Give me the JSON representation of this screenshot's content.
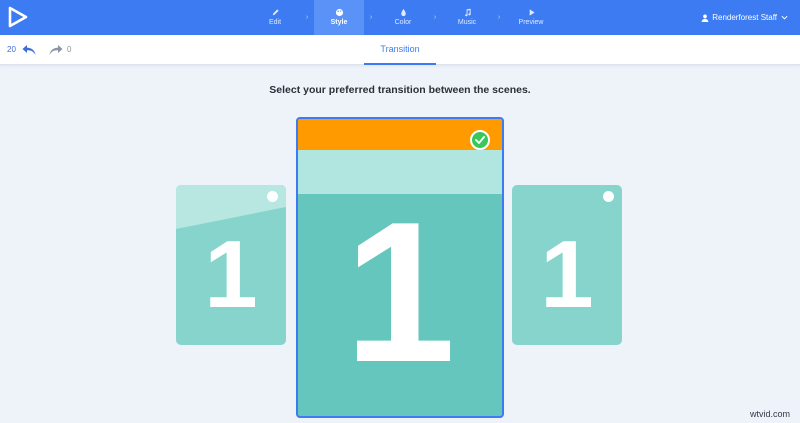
{
  "header": {
    "steps": [
      {
        "label": "Edit",
        "icon": "pencil-icon",
        "active": false
      },
      {
        "label": "Style",
        "icon": "palette-icon",
        "active": true
      },
      {
        "label": "Color",
        "icon": "color-drop-icon",
        "active": false
      },
      {
        "label": "Music",
        "icon": "music-note-icon",
        "active": false
      },
      {
        "label": "Preview",
        "icon": "play-icon",
        "active": false
      }
    ],
    "user_name": "Renderforest Staff"
  },
  "toolbar": {
    "undo_count": "20",
    "redo_count": "0",
    "tab_label": "Transition"
  },
  "main": {
    "prompt": "Select your preferred transition between the scenes.",
    "cards": [
      {
        "digit": "1",
        "selected": false
      },
      {
        "digit": "1",
        "selected": true
      },
      {
        "digit": "1",
        "selected": false
      }
    ]
  },
  "watermark": "wtvid.com",
  "colors": {
    "brand_blue": "#3d7bf2",
    "card_teal": "#64c6bc",
    "card_teal_light": "#86d4cc",
    "accent_orange": "#ff9a00",
    "check_green": "#37c75a"
  }
}
